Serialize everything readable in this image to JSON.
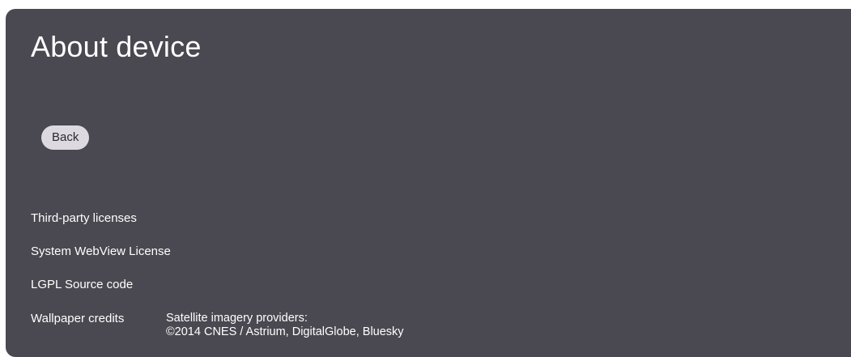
{
  "page": {
    "title": "About device",
    "back_label": "Back"
  },
  "items": [
    {
      "label": "Third-party licenses"
    },
    {
      "label": "System WebView License"
    },
    {
      "label": "LGPL Source code"
    },
    {
      "label": "Wallpaper credits"
    }
  ],
  "wallpaper_credits": {
    "line1": "Satellite imagery providers:",
    "line2": "©2014 CNES / Astrium, DigitalGlobe, Bluesky"
  },
  "colors": {
    "panel_background": "#4a4850",
    "button_background": "#dcdae0",
    "text": "#ffffff"
  }
}
